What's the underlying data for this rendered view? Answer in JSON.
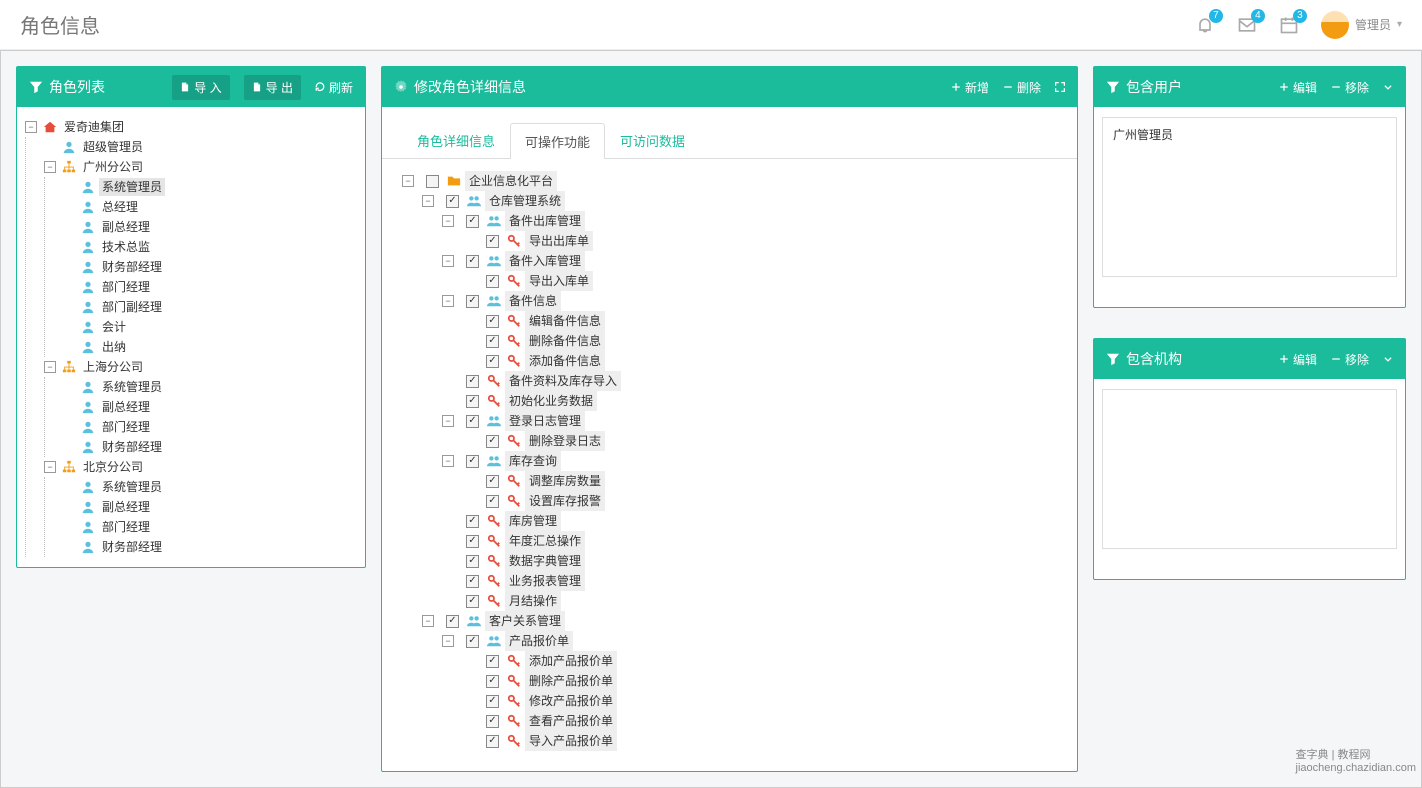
{
  "header": {
    "title": "角色信息",
    "notif_bell": "7",
    "notif_mail": "4",
    "notif_cal": "3",
    "admin_label": "管理员"
  },
  "rolepanel": {
    "title": "角色列表",
    "import": "导 入",
    "export": "导 出",
    "refresh": "刷新",
    "tree": {
      "root": "爱奇迪集团",
      "n1": "超级管理员",
      "n2": "广州分公司",
      "n2c": [
        "系统管理员",
        "总经理",
        "副总经理",
        "技术总监",
        "财务部经理",
        "部门经理",
        "部门副经理",
        "会计",
        "出纳"
      ],
      "n3": "上海分公司",
      "n3c": [
        "系统管理员",
        "副总经理",
        "部门经理",
        "财务部经理"
      ],
      "n4": "北京分公司",
      "n4c": [
        "系统管理员",
        "副总经理",
        "部门经理",
        "财务部经理"
      ]
    }
  },
  "midpanel": {
    "title": "修改角色详细信息",
    "add": "新增",
    "delete": "删除",
    "tab1": "角色详细信息",
    "tab2": "可操作功能",
    "tab3": "可访问数据",
    "perm": {
      "root": "企业信息化平台",
      "c1": "仓库管理系统",
      "c1a": "备件出库管理",
      "c1a1": "导出出库单",
      "c1b": "备件入库管理",
      "c1b1": "导出入库单",
      "c1c": "备件信息",
      "c1c1": "编辑备件信息",
      "c1c2": "删除备件信息",
      "c1c3": "添加备件信息",
      "c1d": "备件资料及库存导入",
      "c1e": "初始化业务数据",
      "c1f": "登录日志管理",
      "c1f1": "删除登录日志",
      "c1g": "库存查询",
      "c1g1": "调整库房数量",
      "c1g2": "设置库存报警",
      "c1h": "库房管理",
      "c1i": "年度汇总操作",
      "c1j": "数据字典管理",
      "c1k": "业务报表管理",
      "c1l": "月结操作",
      "c2": "客户关系管理",
      "c2a": "产品报价单",
      "c2a1": "添加产品报价单",
      "c2a2": "删除产品报价单",
      "c2a3": "修改产品报价单",
      "c2a4": "查看产品报价单",
      "c2a5": "导入产品报价单"
    }
  },
  "userpanel": {
    "title": "包含用户",
    "edit": "编辑",
    "remove": "移除",
    "items": [
      "广州管理员"
    ]
  },
  "orgpanel": {
    "title": "包含机构",
    "edit": "编辑",
    "remove": "移除"
  },
  "watermark1": "查字典",
  "watermark2": "教程网",
  "watermark3": "jiaocheng.chazidian.com"
}
